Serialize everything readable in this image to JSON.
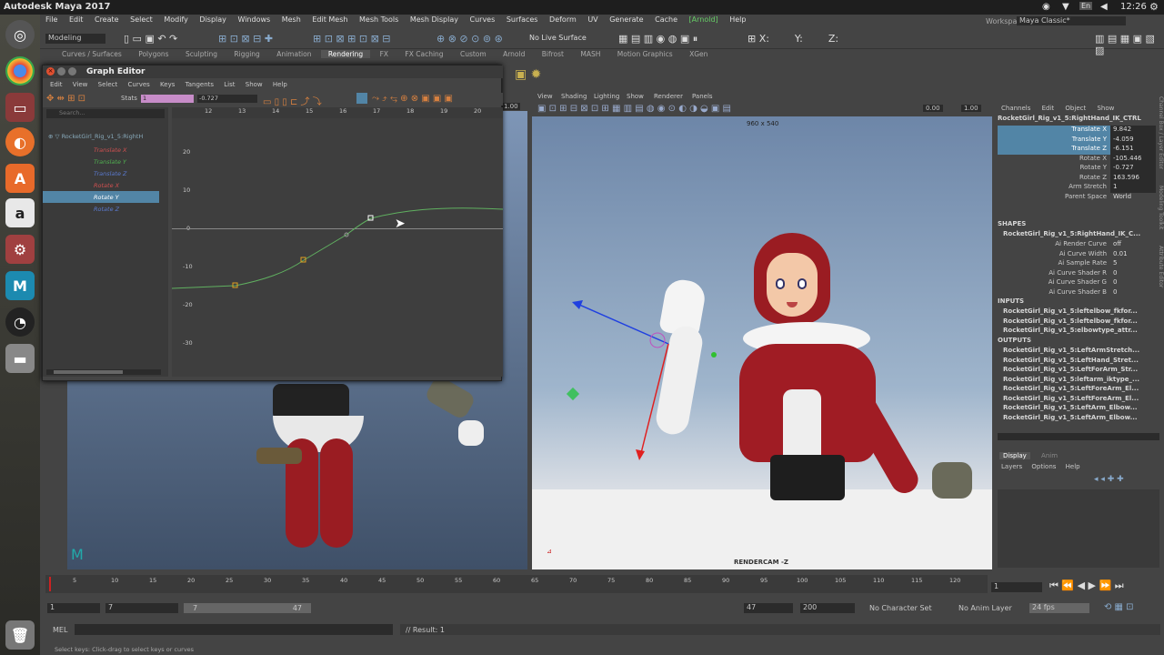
{
  "topbar": {
    "title": "Autodesk Maya 2017",
    "time": "12:26",
    "lang": "En"
  },
  "menubar": [
    "File",
    "Edit",
    "Create",
    "Select",
    "Modify",
    "Display",
    "Windows",
    "Mesh",
    "Edit Mesh",
    "Mesh Tools",
    "Mesh Display",
    "Curves",
    "Surfaces",
    "Deform",
    "UV",
    "Generate",
    "Cache",
    "[Arnold]",
    "Help"
  ],
  "mode": "Modeling",
  "live_surface": "No Live Surface",
  "workspace": {
    "label": "Workspace :",
    "value": "Maya Classic*"
  },
  "shelf_tabs": [
    "Curves / Surfaces",
    "Polygons",
    "Sculpting",
    "Rigging",
    "Animation",
    "Rendering",
    "FX",
    "FX Caching",
    "Custom",
    "Arnold",
    "Bifrost",
    "MASH",
    "Motion Graphics",
    "XGen"
  ],
  "shelf_active": "Rendering",
  "graph_editor": {
    "title": "Graph Editor",
    "menus": [
      "Edit",
      "View",
      "Select",
      "Curves",
      "Keys",
      "Tangents",
      "List",
      "Show",
      "Help"
    ],
    "stats_label": "Stats",
    "stats_frame": "1",
    "stats_value": "-0.727",
    "search_placeholder": "Search...",
    "ruler": [
      "12",
      "13",
      "14",
      "15",
      "16",
      "17",
      "18",
      "19",
      "20"
    ],
    "yticks": [
      "20",
      "10",
      "0",
      "-10",
      "-20",
      "-30"
    ],
    "outliner_root": "RocketGirl_Rig_v1_5:RightH",
    "channels": [
      {
        "label": "Translate X",
        "color": "#d05050"
      },
      {
        "label": "Translate Y",
        "color": "#50b050"
      },
      {
        "label": "Translate Z",
        "color": "#5a7ad0"
      },
      {
        "label": "Rotate X",
        "color": "#d05050"
      },
      {
        "label": "Rotate Y",
        "color": "#50b050"
      },
      {
        "label": "Rotate Z",
        "color": "#5a7ad0"
      }
    ],
    "selected_channel": "Rotate Y"
  },
  "viewport": {
    "menus": [
      "View",
      "Shading",
      "Lighting",
      "Show",
      "Renderer",
      "Panels"
    ],
    "value1": "0.00",
    "value2": "1.00",
    "resolution": "960 x 540",
    "camera": "RENDERCAM -Z"
  },
  "left_viewport": {
    "value": "1.00"
  },
  "channel_box": {
    "menus": [
      "Channels",
      "Edit",
      "Object",
      "Show"
    ],
    "node": "RocketGirl_Rig_v1_5:RightHand_IK_CTRL",
    "channels": [
      {
        "k": "Translate X",
        "v": "9.842",
        "sel": true
      },
      {
        "k": "Translate Y",
        "v": "-4.059",
        "sel": true
      },
      {
        "k": "Translate Z",
        "v": "-6.151",
        "sel": true
      },
      {
        "k": "Rotate X",
        "v": "-105.446",
        "sel": false
      },
      {
        "k": "Rotate Y",
        "v": "-0.727",
        "sel": false
      },
      {
        "k": "Rotate Z",
        "v": "163.596",
        "sel": false
      },
      {
        "k": "Arm Stretch",
        "v": "1",
        "sel": false
      },
      {
        "k": "Parent Space",
        "v": "World",
        "sel": false
      }
    ],
    "shapes_label": "SHAPES",
    "shape_node": "RocketGirl_Rig_v1_5:RightHand_IK_C...",
    "shape_attrs": [
      {
        "k": "Ai Render Curve",
        "v": "off"
      },
      {
        "k": "Ai Curve Width",
        "v": "0.01"
      },
      {
        "k": "Ai Sample Rate",
        "v": "5"
      },
      {
        "k": "Ai Curve Shader R",
        "v": "0"
      },
      {
        "k": "Ai Curve Shader G",
        "v": "0"
      },
      {
        "k": "Ai Curve Shader B",
        "v": "0"
      }
    ],
    "inputs_label": "INPUTS",
    "inputs": [
      "RocketGirl_Rig_v1_5:leftelbow_fkfor...",
      "RocketGirl_Rig_v1_5:leftelbow_fkfor...",
      "RocketGirl_Rig_v1_5:elbowtype_attr..."
    ],
    "outputs_label": "OUTPUTS",
    "outputs": [
      "RocketGirl_Rig_v1_5:LeftArmStretch...",
      "RocketGirl_Rig_v1_5:LeftHand_Stret...",
      "RocketGirl_Rig_v1_5:LeftForArm_Str...",
      "RocketGirl_Rig_v1_5:leftarm_iktype_...",
      "RocketGirl_Rig_v1_5:LeftForeArm_El...",
      "RocketGirl_Rig_v1_5:LeftForeArm_El...",
      "RocketGirl_Rig_v1_5:LeftArm_Elbow...",
      "RocketGirl_Rig_v1_5:LeftArm_Elbow..."
    ],
    "side_tabs": [
      "Channel Box / Layer Editor",
      "Modeling Toolkit",
      "Attribute Editor"
    ]
  },
  "layer_editor": {
    "tabs": [
      "Display",
      "Anim"
    ],
    "menus": [
      "Layers",
      "Options",
      "Help"
    ]
  },
  "timeline": {
    "labels": [
      "5",
      "10",
      "15",
      "20",
      "25",
      "30",
      "35",
      "40",
      "45",
      "50",
      "55",
      "60",
      "65",
      "70",
      "75",
      "80",
      "85",
      "90",
      "95",
      "100",
      "105",
      "110",
      "115",
      "120"
    ],
    "current_frame": "1"
  },
  "range": {
    "start": "1",
    "inner_start": "7",
    "slider_start": "7",
    "slider_end": "47",
    "inner_end": "47",
    "end": "200",
    "char_set": "No Character Set",
    "anim_layer": "No Anim Layer",
    "fps": "24 fps"
  },
  "command": {
    "lang": "MEL",
    "result": "// Result: 1"
  },
  "help": "Select keys: Click-drag to select keys or curves"
}
